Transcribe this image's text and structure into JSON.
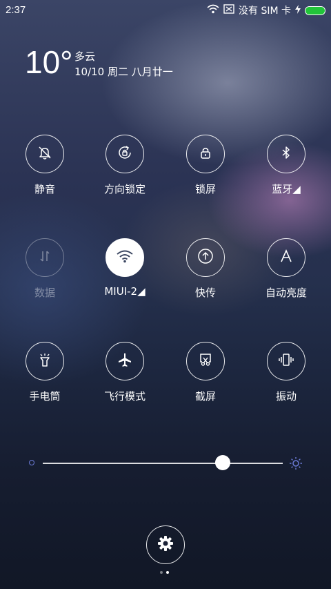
{
  "status_bar": {
    "time": "2:37",
    "carrier": "没有 SIM 卡",
    "battery_color": "#22c43a"
  },
  "weather": {
    "temperature": "10°",
    "condition": "多云",
    "date": "10/10 周二 八月廿一"
  },
  "toggles": [
    {
      "label": "静音",
      "icon": "bell-off-icon",
      "state": "off"
    },
    {
      "label": "方向锁定",
      "icon": "rotation-lock-icon",
      "state": "off"
    },
    {
      "label": "锁屏",
      "icon": "lock-icon",
      "state": "off"
    },
    {
      "label": "蓝牙◢",
      "icon": "bluetooth-icon",
      "state": "off"
    },
    {
      "label": "数据",
      "icon": "mobile-data-icon",
      "state": "disabled"
    },
    {
      "label": "MIUI-2◢",
      "icon": "wifi-icon",
      "state": "on"
    },
    {
      "label": "快传",
      "icon": "quick-transfer-icon",
      "state": "off"
    },
    {
      "label": "自动亮度",
      "icon": "auto-brightness-icon",
      "state": "off"
    },
    {
      "label": "手电筒",
      "icon": "flashlight-icon",
      "state": "off"
    },
    {
      "label": "飞行模式",
      "icon": "airplane-icon",
      "state": "off"
    },
    {
      "label": "截屏",
      "icon": "screenshot-icon",
      "state": "off"
    },
    {
      "label": "振动",
      "icon": "vibrate-icon",
      "state": "off"
    }
  ],
  "brightness": {
    "level": 0.75,
    "accent": "#6b7bd6"
  },
  "pager": {
    "pages": 2,
    "current": 2
  }
}
